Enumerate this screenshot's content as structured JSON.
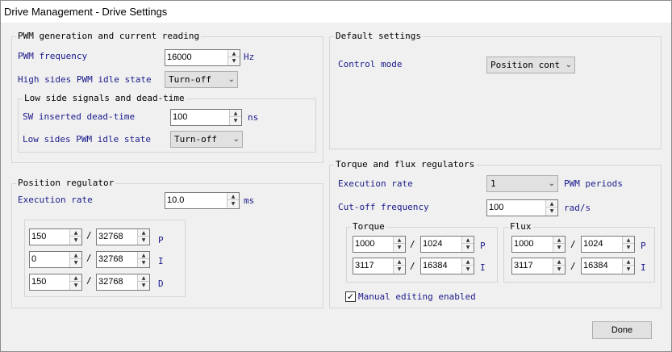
{
  "window": {
    "title": "Drive Management - Drive Settings"
  },
  "pwm": {
    "legend": "PWM generation and current reading",
    "freq_label": "PWM frequency",
    "freq_value": "16000",
    "freq_unit": "Hz",
    "high_idle_label": "High sides PWM idle state",
    "high_idle_value": "Turn-off",
    "low": {
      "legend": "Low side signals and dead-time",
      "deadtime_label": "SW inserted dead-time",
      "deadtime_value": "100",
      "deadtime_unit": "ns",
      "low_idle_label": "Low sides PWM idle state",
      "low_idle_value": "Turn-off"
    }
  },
  "defaults": {
    "legend": "Default settings",
    "control_label": "Control mode",
    "control_value": "Position contr"
  },
  "position": {
    "legend": "Position regulator",
    "exec_label": "Execution rate",
    "exec_value": "10.0",
    "exec_unit": "ms",
    "gains": [
      {
        "num": "150",
        "den": "32768",
        "label": "P"
      },
      {
        "num": "0",
        "den": "32768",
        "label": "I"
      },
      {
        "num": "150",
        "den": "32768",
        "label": "D"
      }
    ],
    "slash": "/"
  },
  "torque_flux": {
    "legend": "Torque and flux regulators",
    "exec_label": "Execution rate",
    "exec_value": "1",
    "exec_unit": "PWM periods",
    "cutoff_label": "Cut-off frequency",
    "cutoff_value": "100",
    "cutoff_unit": "rad/s",
    "torque": {
      "legend": "Torque",
      "rows": [
        {
          "num": "1000",
          "den": "1024",
          "label": "P"
        },
        {
          "num": "3117",
          "den": "16384",
          "label": "I"
        }
      ]
    },
    "flux": {
      "legend": "Flux",
      "rows": [
        {
          "num": "1000",
          "den": "1024",
          "label": "P"
        },
        {
          "num": "3117",
          "den": "16384",
          "label": "I"
        }
      ]
    },
    "manual_label": "Manual editing enabled",
    "manual_checked": "✓"
  },
  "done_label": "Done",
  "icons": {
    "up": "▲",
    "down": "▼",
    "chevron": "⌄"
  }
}
